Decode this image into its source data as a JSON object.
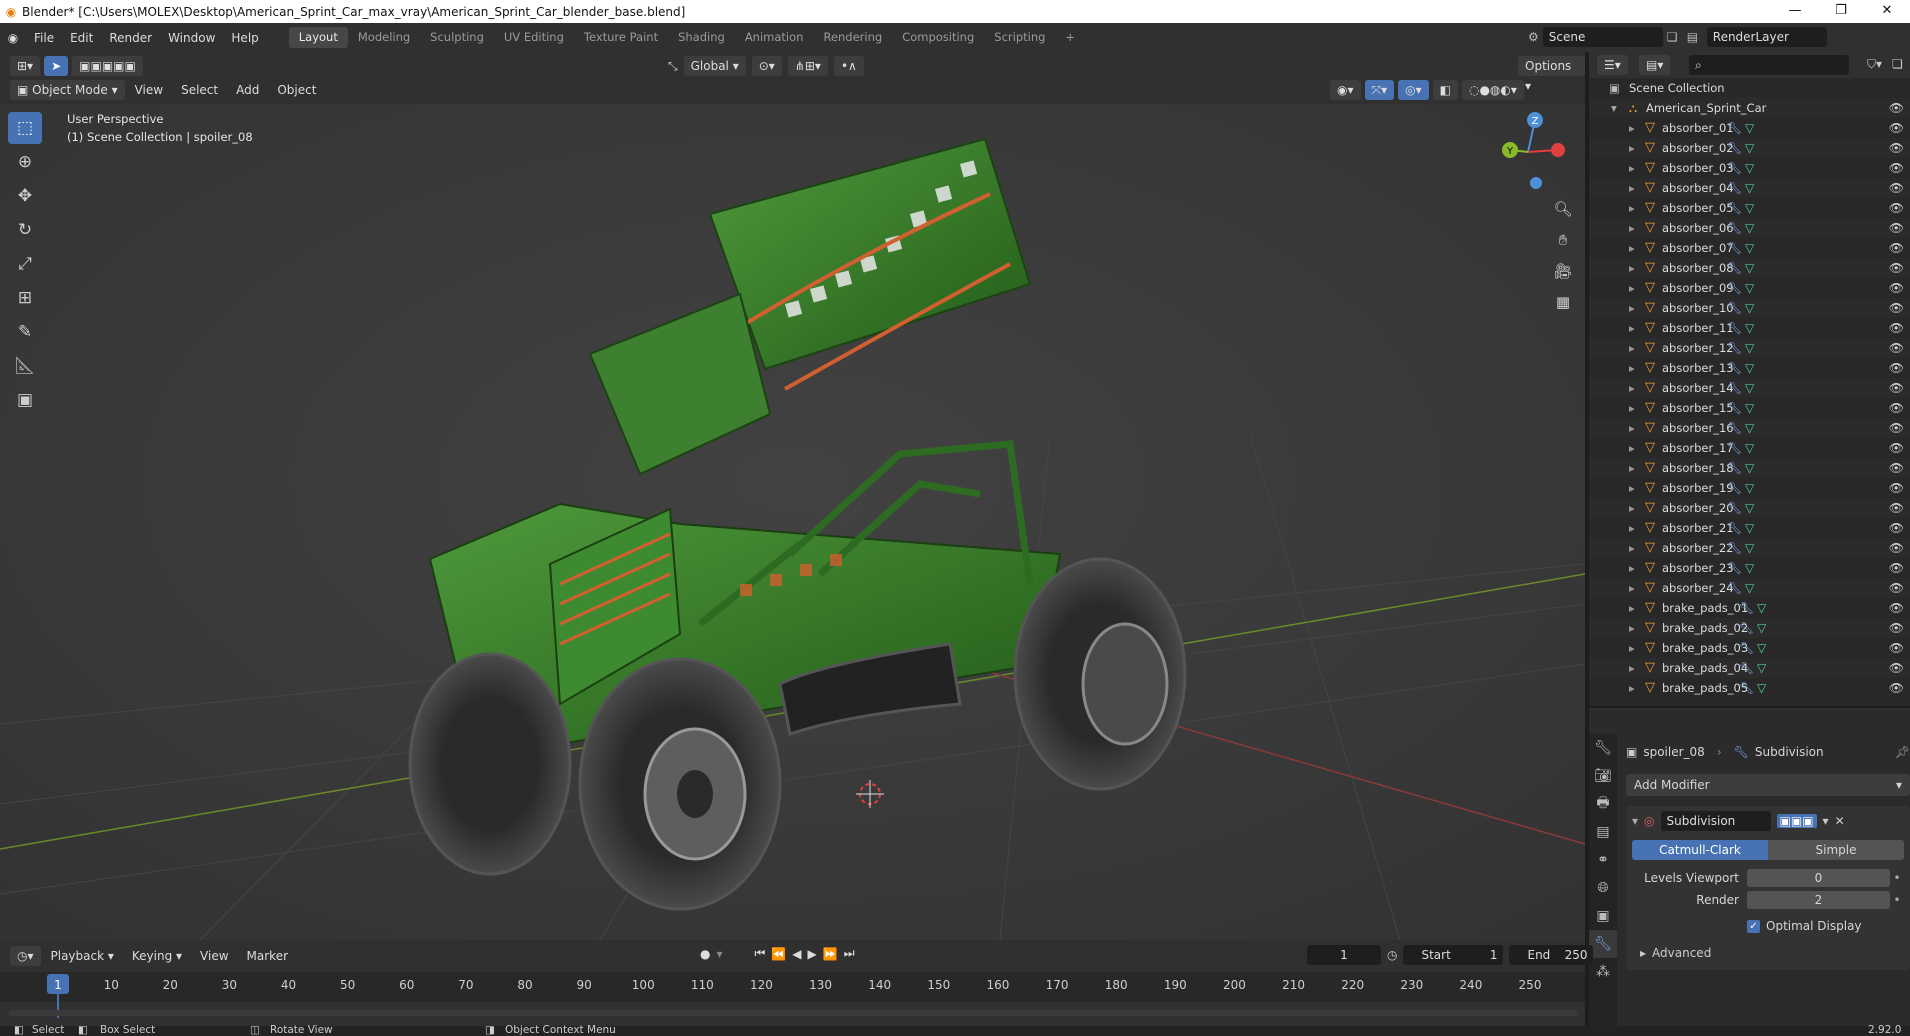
{
  "window": {
    "title": "Blender* [C:\\Users\\MOLEX\\Desktop\\American_Sprint_Car_max_vray\\American_Sprint_Car_blender_base.blend]",
    "minimize": "—",
    "maximize": "❐",
    "close": "✕"
  },
  "menus": [
    "File",
    "Edit",
    "Render",
    "Window",
    "Help"
  ],
  "workspaces": [
    "Layout",
    "Modeling",
    "Sculpting",
    "UV Editing",
    "Texture Paint",
    "Shading",
    "Animation",
    "Rendering",
    "Compositing",
    "Scripting"
  ],
  "workspace_add": "+",
  "scene": {
    "name": "Scene",
    "view_layer": "RenderLayer"
  },
  "viewport_header": {
    "mode": "Object Mode",
    "menus": [
      "View",
      "Select",
      "Add",
      "Object"
    ],
    "transform_orientation": "Global",
    "options": "Options"
  },
  "viewport_info": {
    "line1": "User Perspective",
    "line2": "(1) Scene Collection | spoiler_08"
  },
  "gizmo": {
    "z": "Z",
    "y": "Y"
  },
  "outliner": {
    "root": "Scene Collection",
    "collection": "American_Sprint_Car",
    "items": [
      "absorber_01",
      "absorber_02",
      "absorber_03",
      "absorber_04",
      "absorber_05",
      "absorber_06",
      "absorber_07",
      "absorber_08",
      "absorber_09",
      "absorber_10",
      "absorber_11",
      "absorber_12",
      "absorber_13",
      "absorber_14",
      "absorber_15",
      "absorber_16",
      "absorber_17",
      "absorber_18",
      "absorber_19",
      "absorber_20",
      "absorber_21",
      "absorber_22",
      "absorber_23",
      "absorber_24",
      "brake_pads_01",
      "brake_pads_02",
      "brake_pads_03",
      "brake_pads_04",
      "brake_pads_05"
    ]
  },
  "properties": {
    "object": "spoiler_08",
    "modifier_context": "Subdivision",
    "add_modifier": "Add Modifier",
    "modifier_name": "Subdivision",
    "catmull_clark": "Catmull-Clark",
    "simple": "Simple",
    "levels_viewport_label": "Levels Viewport",
    "levels_viewport": "0",
    "render_label": "Render",
    "render_value": "2",
    "optimal_display": "Optimal Display",
    "advanced": "Advanced"
  },
  "timeline": {
    "menus": [
      "Playback",
      "Keying",
      "View",
      "Marker"
    ],
    "current_frame": "1",
    "start_label": "Start",
    "start": "1",
    "end_label": "End",
    "end": "250",
    "ticks": [
      "1",
      "10",
      "20",
      "30",
      "40",
      "50",
      "60",
      "70",
      "80",
      "90",
      "100",
      "110",
      "120",
      "130",
      "140",
      "150",
      "160",
      "170",
      "180",
      "190",
      "200",
      "210",
      "220",
      "230",
      "240",
      "250"
    ]
  },
  "statusbar": {
    "select": "Select",
    "box_select": "Box Select",
    "rotate_view": "Rotate View",
    "context_menu": "Object Context Menu",
    "version": "2.92.0"
  },
  "colors": {
    "accent": "#4772b3",
    "car_green": "#2e6e22",
    "tire": "#3a3a3a",
    "axis_x": "#c04040",
    "axis_y": "#7aa02a"
  }
}
